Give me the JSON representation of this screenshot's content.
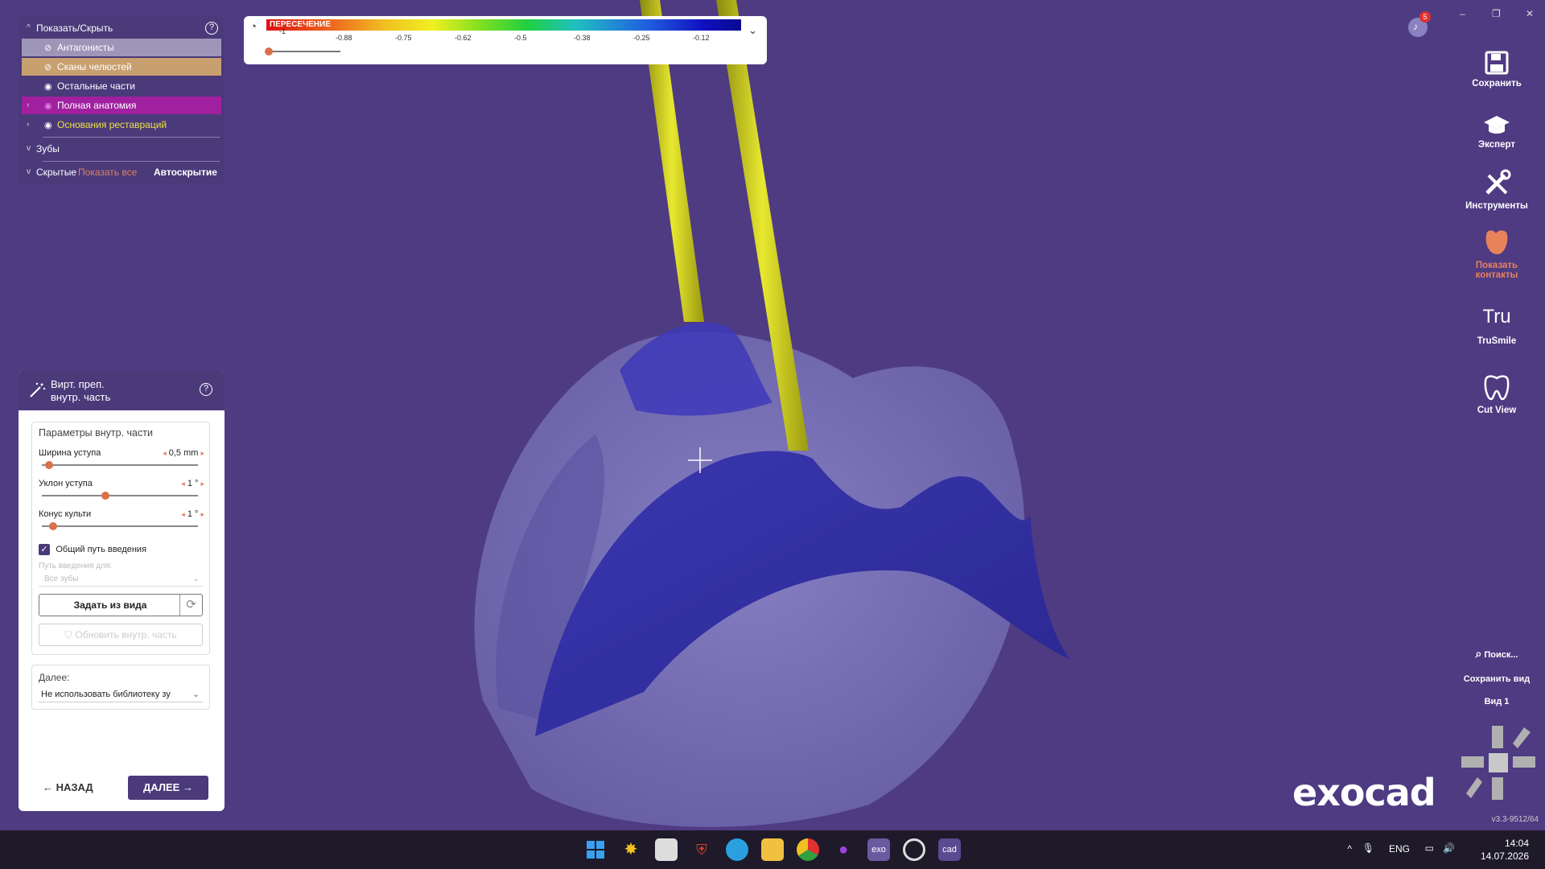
{
  "app": {
    "brand": "exocad",
    "version": "v3.3-9512/64"
  },
  "showhide": {
    "title": "Показать/Скрыть",
    "items": [
      {
        "label": "Антагонисты"
      },
      {
        "label": "Сканы челюстей"
      },
      {
        "label": "Остальные части"
      },
      {
        "label": "Полная анатомия"
      },
      {
        "label": "Основания реставраций"
      }
    ],
    "teeth": "Зубы",
    "hidden": "Скрытые",
    "show_all": "Показать все",
    "autohide": "Автоскрытие"
  },
  "prep": {
    "title_line1": "Вирт. преп.",
    "title_line2": "внутр. часть",
    "params_title": "Параметры внутр. части",
    "sliders": [
      {
        "label": "Ширина уступа",
        "value": "0,5 mm",
        "fraction": 0.02
      },
      {
        "label": "Уклон уступа",
        "value": "1 °",
        "fraction": 0.4
      },
      {
        "label": "Конус культи",
        "value": "1 °",
        "fraction": 0.05
      }
    ],
    "common_path": "Общий путь введения",
    "path_for": "Путь введения для:",
    "path_select": "Все зубы",
    "set_from_view": "Задать из вида",
    "update_inner": "Обновить внутр. часть",
    "next_label": "Далее:",
    "next_select": "Не использовать библиотеку зу",
    "back": "НАЗАД",
    "next": "ДАЛЕЕ"
  },
  "colorbar": {
    "title": "ПЕРЕСЕЧЕНИЕ",
    "ticks": [
      "-1",
      "-0.88",
      "-0.75",
      "-0.62",
      "-0.5",
      "-0.38",
      "-0.25",
      "-0.12"
    ]
  },
  "toolbar": {
    "save": "Сохранить",
    "expert": "Эксперт",
    "tools": "Инструменты",
    "contacts": "Показать контакты",
    "trusmile": "TruSmile",
    "trusmile_logo": "Tru",
    "cutview": "Cut View",
    "search": "Поиск...",
    "save_view": "Сохранить вид",
    "view1": "Вид 1",
    "notifications": "5"
  },
  "taskbar": {
    "lang": "ENG",
    "time": "14:04",
    "date": "14.07.2026",
    "exo_label": "exo",
    "cad_label": "cad"
  },
  "colors": {
    "panel": "#4a3a7a",
    "viewport": "#4e3b82",
    "accent": "#d9724a",
    "magenta": "#a020a0",
    "tan": "#c8a070"
  }
}
